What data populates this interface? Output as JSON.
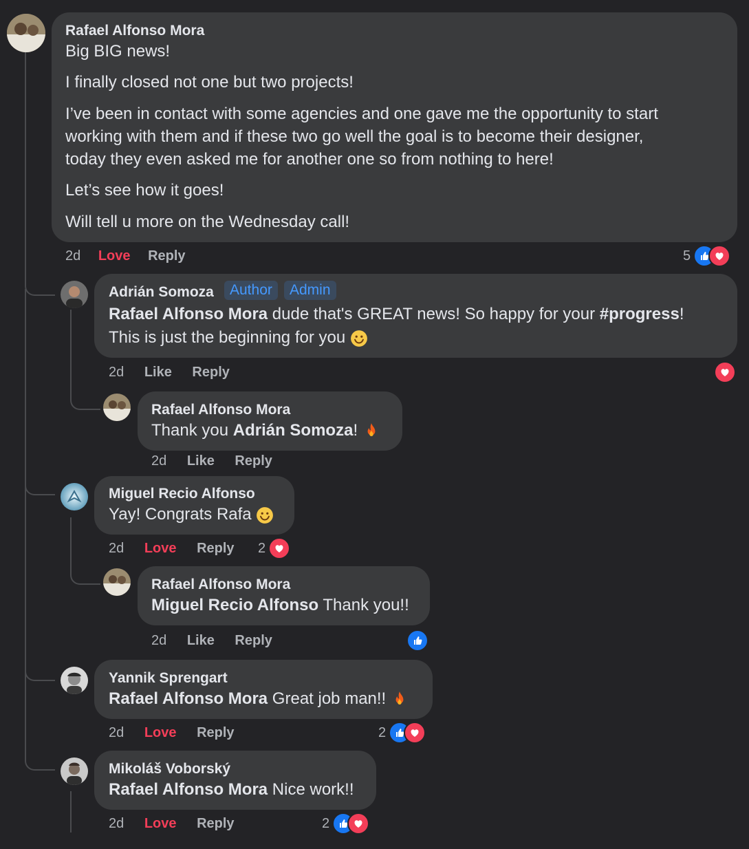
{
  "labels": {
    "love": "Love",
    "like": "Like",
    "reply": "Reply"
  },
  "colors": {
    "background": "#232326",
    "bubble": "#3a3b3d",
    "love": "#f33e58",
    "like": "#1877f2",
    "badge_text": "#4599ff"
  },
  "post": {
    "author": "Rafael Alfonso Mora",
    "paragraphs": [
      "Big BIG news!",
      "I finally closed not one but two projects!",
      "I’ve been in contact with some agencies and one gave me the opportunity to start",
      "working with them and if these two go well the goal is to become their designer,",
      "today they even asked me for another one so from nothing to here!",
      "Let’s see how it goes!",
      "Will tell u more on the Wednesday call!"
    ],
    "time": "2d",
    "reaction_count": "5",
    "reactions": [
      "like-icon",
      "heart-icon"
    ]
  },
  "comments": [
    {
      "author": "Adrián Somoza",
      "badges": [
        "Author",
        "Admin"
      ],
      "mention": "Rafael Alfonso Mora",
      "text_a": " dude that's GREAT news! So happy for your ",
      "hashtag": "#progress",
      "text_b": "!",
      "line2": "This is just the beginning for you",
      "emoji": "smile",
      "time": "2d",
      "reactions": [
        "heart-icon"
      ],
      "reply": {
        "author": "Rafael Alfonso Mora",
        "text": "Thank you ",
        "mention": "Adrián Somoza",
        "after": "!",
        "emoji": "fire",
        "time": "2d"
      }
    },
    {
      "author": "Miguel Recio Alfonso",
      "text": "Yay! Congrats Rafa",
      "emoji": "smile",
      "time": "2d",
      "reaction_count": "2",
      "reactions": [
        "heart-icon"
      ],
      "reply": {
        "author": "Rafael Alfonso Mora",
        "mention": "Miguel Recio Alfonso",
        "text": " Thank you!!",
        "time": "2d",
        "reactions": [
          "like-icon"
        ]
      }
    },
    {
      "author": "Yannik Sprengart",
      "mention": "Rafael Alfonso Mora",
      "text": " Great job man!!",
      "emoji": "fire",
      "time": "2d",
      "reaction_count": "2",
      "reactions": [
        "like-icon",
        "heart-icon"
      ]
    },
    {
      "author": "Mikoláš Voborský",
      "mention": "Rafael Alfonso Mora",
      "text": " Nice work!!",
      "time": "2d",
      "reaction_count": "2",
      "reactions": [
        "like-icon",
        "heart-icon"
      ]
    }
  ]
}
